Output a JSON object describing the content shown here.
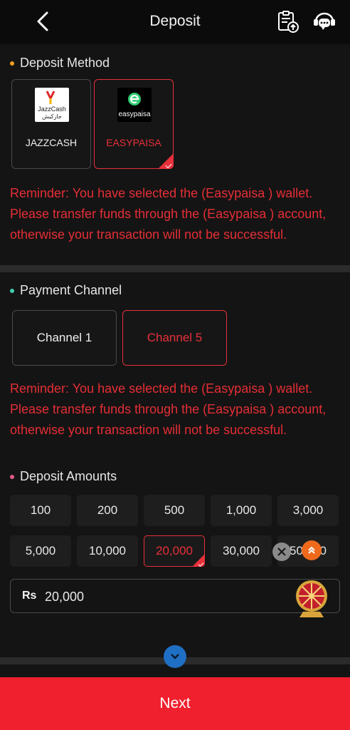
{
  "header": {
    "title": "Deposit"
  },
  "deposit_method": {
    "title": "Deposit Method",
    "dot_color": "#f0a020",
    "methods": [
      {
        "label": "JAZZCASH",
        "logo_text": "JazzCash",
        "logo_text_urdu": "جازکیش",
        "selected": false
      },
      {
        "label": "EASYPAISA",
        "logo_text": "easypaisa",
        "selected": true
      }
    ],
    "reminder": "Reminder: You have selected the (Easypaisa ) wallet. Please transfer funds through the (Easypaisa ) account, otherwise your transaction will not be successful."
  },
  "payment_channel": {
    "title": "Payment Channel",
    "dot_color": "#3fd0b0",
    "channels": [
      {
        "label": "Channel 1",
        "selected": false
      },
      {
        "label": "Channel 5",
        "selected": true
      }
    ],
    "reminder": "Reminder: You have selected the (Easypaisa ) wallet. Please transfer funds through the (Easypaisa ) account, otherwise your transaction will not be successful."
  },
  "deposit_amounts": {
    "title": "Deposit Amounts",
    "dot_color": "#e05a8a",
    "amounts": [
      "100",
      "200",
      "500",
      "1,000",
      "3,000",
      "5,000",
      "10,000",
      "20,000",
      "30,000",
      "50,000"
    ],
    "selected_amount": "20,000",
    "currency_symbol": "Rs",
    "input_value": "20,000"
  },
  "next_button": {
    "label": "Next"
  },
  "colors": {
    "accent": "#e8303a",
    "next_bg": "#f0202e",
    "background": "#141414"
  }
}
